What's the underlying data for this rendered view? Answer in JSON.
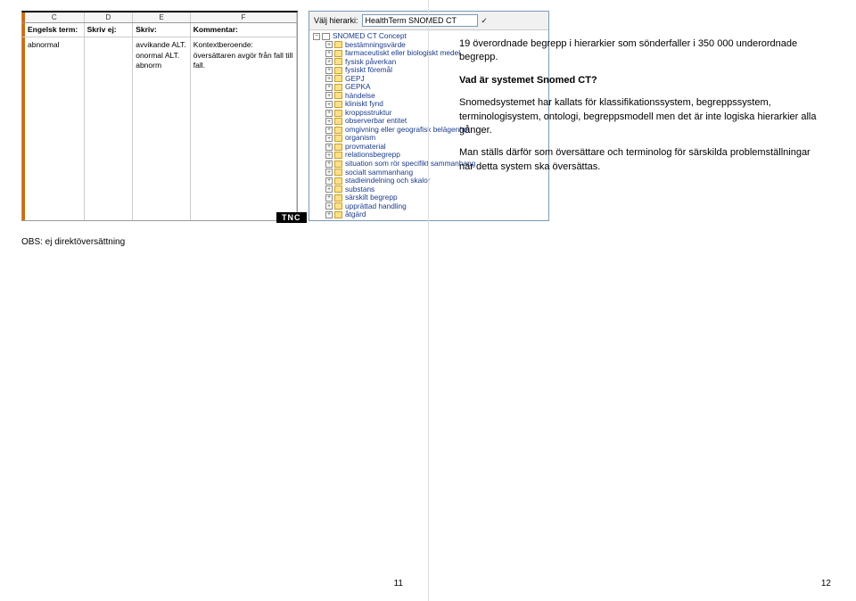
{
  "slide11": {
    "cols": {
      "c": "C",
      "d": "D",
      "e": "E",
      "f": "F"
    },
    "header": {
      "term": "Engelsk term:",
      "skriv_ej": "Skriv ej:",
      "skriv": "Skriv:",
      "kommentar": "Kommentar:"
    },
    "row": {
      "term": "abnormal",
      "skriv_ej": "",
      "skriv": "avvikande ALT. onormal ALT. abnorm",
      "kommentar": "Kontextberoende: översättaren avgör från fall till fall."
    },
    "note": "OBS: ej direktöversättning",
    "tnc": "TNC",
    "tree": {
      "label": "Välj hierarki:",
      "select": "HealthTerm SNOMED CT",
      "ok": "✓",
      "root": "SNOMED CT Concept",
      "items": [
        "bestämningsvärde",
        "farmaceutiskt eller biologiskt medel",
        "fysisk påverkan",
        "fysiskt föremål",
        "GEPJ",
        "GEPKA",
        "händelse",
        "kliniskt fynd",
        "kroppsstruktur",
        "observerbar entitet",
        "omgivning eller geografisk belägenhet",
        "organism",
        "provmaterial",
        "relationsbegrepp",
        "situation som rör specifikt sammanhang",
        "socialt sammanhang",
        "stadieindelning och skalor",
        "substans",
        "särskilt begrepp",
        "upprättad handling",
        "åtgärd"
      ]
    },
    "pagenum": "11"
  },
  "slide12": {
    "p1": "19 överordnade begrepp i hierarkier som sönderfaller i 350 000 underordnade begrepp.",
    "q": "Vad är systemet Snomed CT?",
    "p2": "Snomedsystemet har kallats för klassifikationssystem, begreppssystem, terminologisystem, ontologi, begreppsmodell men det är inte logiska hierarkier alla gånger.",
    "p3": "Man ställs därför som översättare och terminolog för särskilda problemställningar när detta system ska översättas.",
    "pagenum": "12"
  }
}
